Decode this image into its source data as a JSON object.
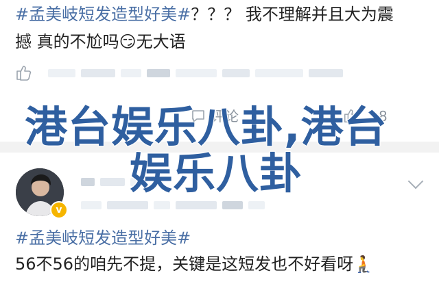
{
  "post1": {
    "hashtag": "#孟美岐短发造型好美#",
    "text_line1": "？？？ 我不理解并且大为震",
    "text_line2_a": "撼 真的不尬吗",
    "emoji": "😏",
    "text_line2_b": "无大语",
    "comment_label": "评论",
    "count": "8"
  },
  "overlay": {
    "line1": "港台娱乐八卦,港台",
    "line2": "娱乐八卦"
  },
  "post2": {
    "hashtag": "#孟美岐短发造型好美#",
    "text": "56不56的咱先不提，关键是这短发也不好看呀",
    "emoji": "🧎",
    "verified_mark": "v"
  },
  "icons": {
    "like": "thumbs-up-icon",
    "comment": "comment-icon",
    "like2": "thumbs-up-icon",
    "chevron": "chevron-down-icon"
  }
}
